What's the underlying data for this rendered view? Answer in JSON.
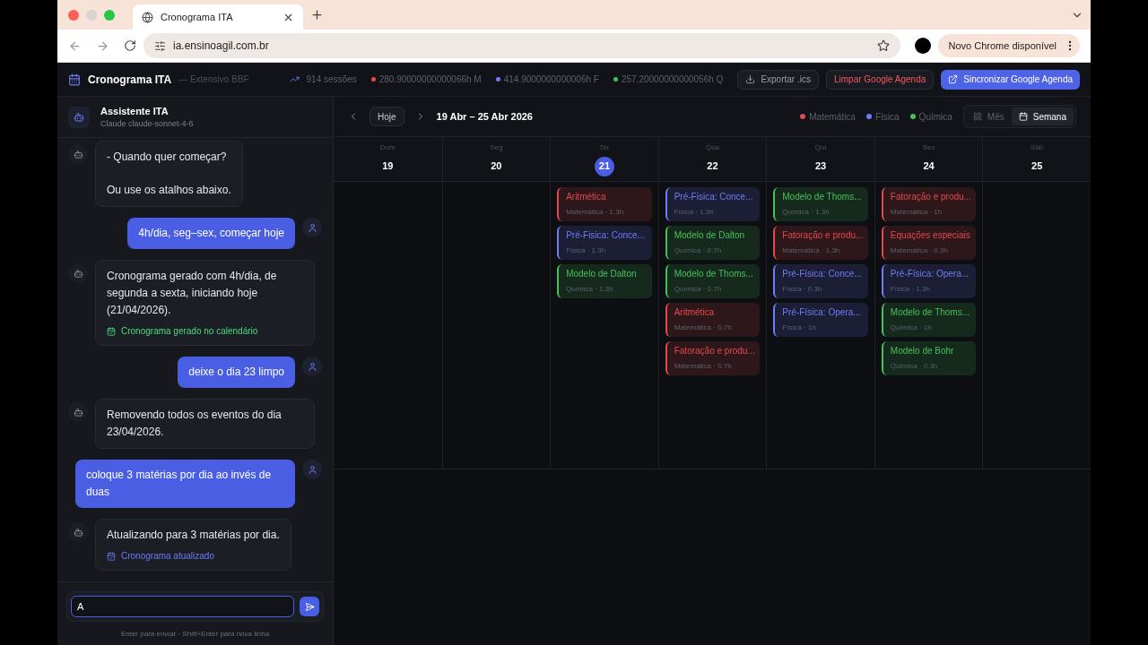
{
  "browser": {
    "tab": {
      "title": "Cronograma ITA",
      "selected": true
    },
    "url": "ia.ensinoagil.com.br",
    "update_label": "Novo Chrome disponível"
  },
  "header": {
    "title": "Cronograma ITA",
    "subtitle": "— Extensivo BBF",
    "sessions": "914 sessões",
    "stats": [
      {
        "text": "280.90000000000066h M",
        "color": "#e5484d"
      },
      {
        "text": "414.9000000000006h F",
        "color": "#6e7cf5"
      },
      {
        "text": "257.20000000000056h Q",
        "color": "#46c15a"
      }
    ],
    "buttons": [
      {
        "label": "Exportar .ics",
        "kind": "export"
      },
      {
        "label": "Limpar Google Agenda",
        "kind": "danger"
      },
      {
        "label": "Sincronizar Google Agenda",
        "kind": "primary"
      }
    ]
  },
  "assistant": {
    "name": "Assistente ITA",
    "model": "Claude claude-sonnet-4-6",
    "messages": [
      {
        "kind": "bot",
        "lines": [
          "- Quando quer começar?",
          "Ou use os atalhos abaixo."
        ]
      },
      {
        "kind": "user",
        "lines": [
          "4h/dia, seg–sex, começar hoje"
        ]
      },
      {
        "kind": "bot",
        "lines": [
          "Cronograma gerado com 4h/dia, de segunda a sexta, iniciando hoje (21/04/2026)."
        ],
        "note": {
          "text": "Cronograma gerado no calendário",
          "color": "#4ade80"
        }
      },
      {
        "kind": "user",
        "lines": [
          "deixe o dia 23 limpo"
        ]
      },
      {
        "kind": "bot",
        "lines": [
          "Removendo todos os eventos do dia 23/04/2026."
        ]
      },
      {
        "kind": "user",
        "lines": [
          "coloque 3 matérias por dia ao invés de duas"
        ]
      },
      {
        "kind": "bot",
        "lines": [
          "Atualizando para 3 matérias por dia."
        ],
        "note": {
          "text": "Cronograma atualizado",
          "color": "#6b7cf6"
        }
      }
    ],
    "input_value": "A",
    "hint": "Enter para enviar · Shift+Enter para nova linha"
  },
  "calendar": {
    "today_label": "Hoje",
    "range": "19 Abr – 25 Abr 2026",
    "legend": [
      {
        "label": "Matemática",
        "color": "#e5484d"
      },
      {
        "label": "Física",
        "color": "#6e7cf5"
      },
      {
        "label": "Química",
        "color": "#46c15a"
      }
    ],
    "views": [
      {
        "label": "Mês",
        "selected": false,
        "kind": "month"
      },
      {
        "label": "Semana",
        "selected": true,
        "kind": "week"
      }
    ],
    "days": [
      {
        "name": "Dom",
        "number": "19",
        "selected": false
      },
      {
        "name": "Seg",
        "number": "20",
        "selected": false
      },
      {
        "name": "Ter",
        "number": "21",
        "selected": true,
        "events": [
          {
            "title": "Aritmética",
            "meta": "Matemática · 1.3h",
            "color": "#e5484d"
          },
          {
            "title": "Pré-Fisica: Conce...",
            "meta": "Física · 1.3h",
            "color": "#6e7cf5"
          },
          {
            "title": "Modelo de Dalton",
            "meta": "Química · 1.3h",
            "color": "#46c15a"
          }
        ]
      },
      {
        "name": "Qua",
        "number": "22",
        "selected": false,
        "events": [
          {
            "title": "Pré-Fisica: Conce...",
            "meta": "Física · 1.3h",
            "color": "#6e7cf5"
          },
          {
            "title": "Modelo de Dalton",
            "meta": "Química · 0.7h",
            "color": "#46c15a"
          },
          {
            "title": "Modelo de Thoms...",
            "meta": "Química · 0.7h",
            "color": "#46c15a"
          },
          {
            "title": "Aritmética",
            "meta": "Matemática · 0.7h",
            "color": "#e5484d"
          },
          {
            "title": "Fatoração e produ...",
            "meta": "Matemática · 0.7h",
            "color": "#e5484d"
          }
        ]
      },
      {
        "name": "Qui",
        "number": "23",
        "selected": false,
        "events": [
          {
            "title": "Modelo de Thoms...",
            "meta": "Química · 1.3h",
            "color": "#46c15a"
          },
          {
            "title": "Fatoração e produ...",
            "meta": "Matemática · 1.3h",
            "color": "#e5484d"
          },
          {
            "title": "Pré-Física: Conce...",
            "meta": "Física · 0.3h",
            "color": "#6e7cf5"
          },
          {
            "title": "Pré-Física: Opera...",
            "meta": "Física · 1h",
            "color": "#6e7cf5"
          }
        ]
      },
      {
        "name": "Sex",
        "number": "24",
        "selected": false,
        "events": [
          {
            "title": "Fatoração e produ...",
            "meta": "Matemática · 1h",
            "color": "#e5484d"
          },
          {
            "title": "Equações especiais",
            "meta": "Matemática · 0.3h",
            "color": "#e5484d"
          },
          {
            "title": "Pré-Física: Opera...",
            "meta": "Física · 1.3h",
            "color": "#6e7cf5"
          },
          {
            "title": "Modelo de Thoms...",
            "meta": "Química · 1h",
            "color": "#46c15a"
          },
          {
            "title": "Modelo de Bohr",
            "meta": "Química · 0.3h",
            "color": "#46c15a"
          }
        ]
      },
      {
        "name": "Sáb",
        "number": "25",
        "selected": false
      }
    ]
  }
}
